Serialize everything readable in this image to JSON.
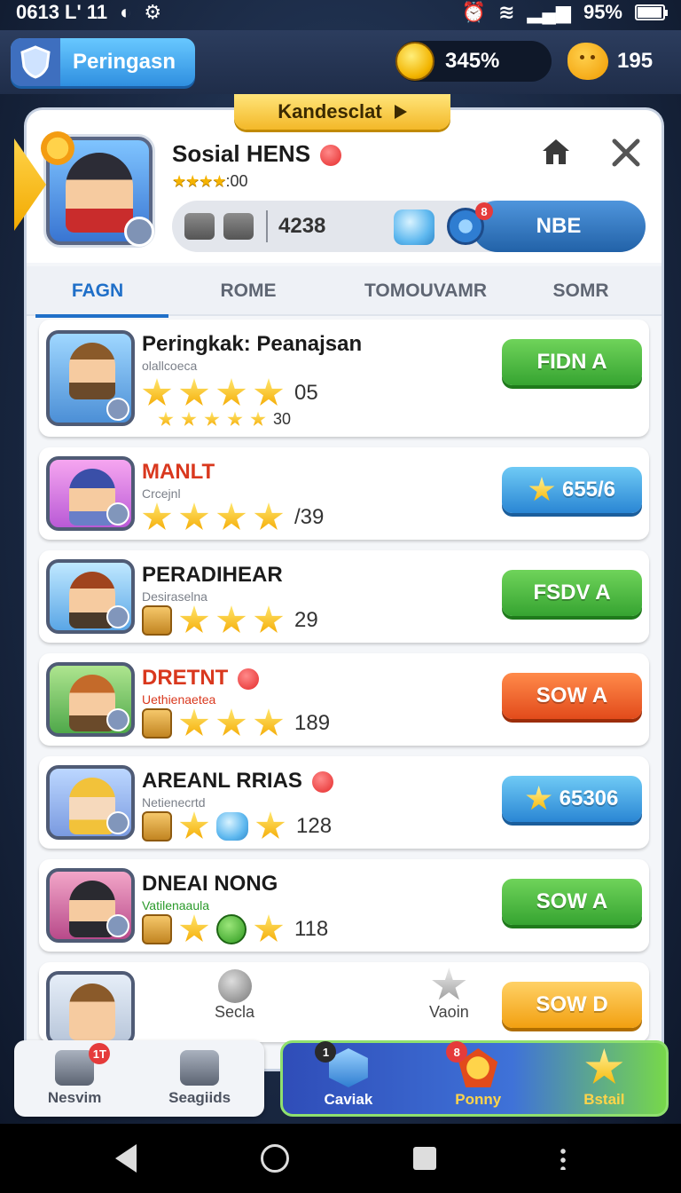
{
  "status_bar": {
    "time": "0613 L' 11",
    "battery": "95%",
    "battery_level": 0.95
  },
  "top_bar": {
    "rank_label": "Peringasn",
    "coins": "345%",
    "gems": "195",
    "icons": [
      "shield-icon",
      "coin-icon",
      "blob-icon"
    ]
  },
  "panel_tab": {
    "label": "Kandesclat"
  },
  "profile": {
    "name": "Sosial HENS",
    "rating_suffix": ":00",
    "rating_stars": 4,
    "stat_value": "4238",
    "badge_count": "8",
    "action_label": "NBE"
  },
  "tabs": [
    {
      "label": "FAGN"
    },
    {
      "label": "ROME"
    },
    {
      "label": "TOMOUVAMR"
    },
    {
      "label": "SOMR"
    }
  ],
  "list": [
    {
      "title": "Peringkak: Peanajsan",
      "subtitle": "olallcoeca",
      "reward": "05",
      "sub_reward": "30",
      "button": "FIDN A",
      "button_color": "#36a431"
    },
    {
      "title": "MANLT",
      "subtitle": "Crcejnl",
      "reward": "/39",
      "button": "655/6",
      "button_color": "#2a86d4"
    },
    {
      "title": "PERADIHEAR",
      "subtitle": "Desiraselna",
      "reward": "29",
      "button": "FSDV A",
      "button_color": "#36a431"
    },
    {
      "title": "DRETNT",
      "subtitle": "Uethienaetea",
      "reward": "189",
      "button": "SOW A",
      "button_color": "#e24b1b"
    },
    {
      "title": "AREANL RRIAS",
      "subtitle": "Netienecrtd",
      "reward": "128",
      "button": "65306",
      "button_color": "#2a86d4"
    },
    {
      "title": "DNEAI NONG",
      "subtitle": "Vatilenaaula",
      "reward": "118",
      "button": "SOW A",
      "button_color": "#36a431"
    }
  ],
  "partial_row": {
    "item_1": "Secla",
    "item_2": "Vaoin",
    "button": "SOW D"
  },
  "bottom_nav": {
    "left": [
      {
        "label": "Nesvim",
        "badge": "1T"
      },
      {
        "label": "Seagiids"
      }
    ],
    "right": [
      {
        "label": "Caviak",
        "badge": "1"
      },
      {
        "label": "Ponny",
        "badge": "8"
      },
      {
        "label": "Bstail"
      }
    ]
  }
}
